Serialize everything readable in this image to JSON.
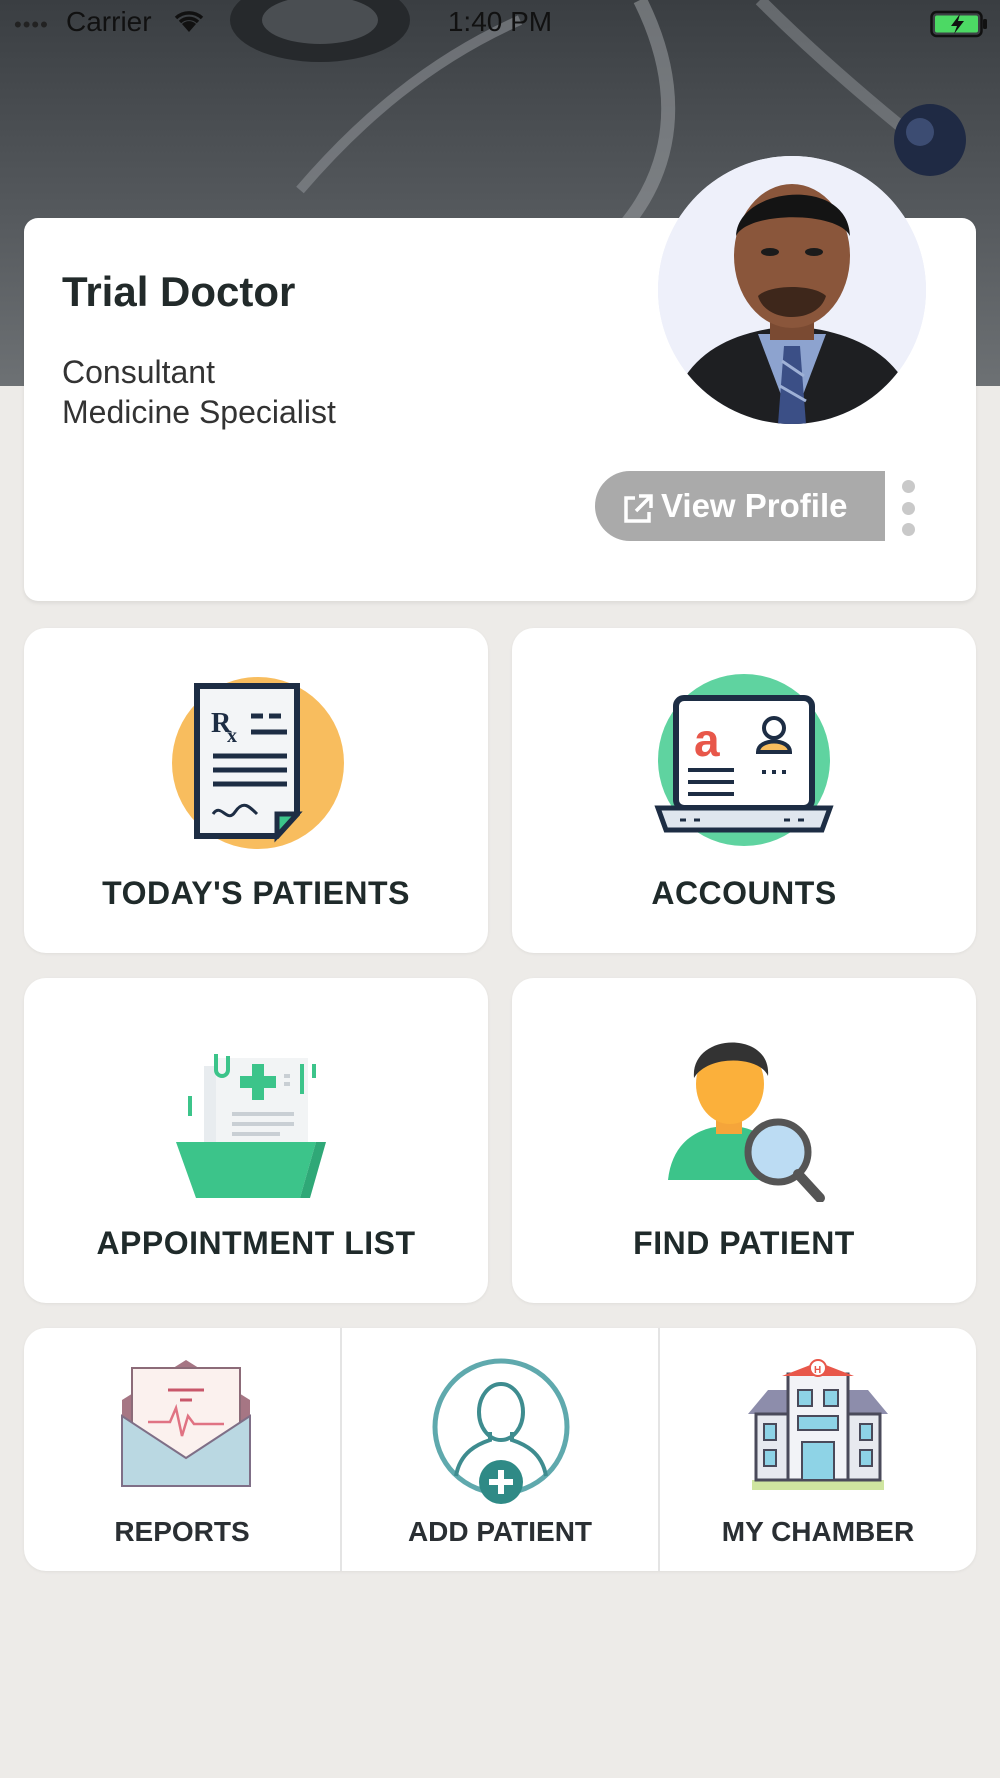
{
  "status_bar": {
    "carrier": "Carrier",
    "time": "1:40 PM"
  },
  "profile": {
    "name": "Trial Doctor",
    "title": "Consultant",
    "specialty": "Medicine Specialist",
    "view_profile_label": "View Profile"
  },
  "tiles": {
    "todays_patients": "TODAY'S PATIENTS",
    "accounts": "ACCOUNTS",
    "appointment_list": "APPOINTMENT LIST",
    "find_patient": "FIND PATIENT",
    "reports": "REPORTS",
    "add_patient": "ADD PATIENT",
    "my_chamber": "MY CHAMBER"
  },
  "icons": {
    "todays_patients": "prescription-icon",
    "accounts": "laptop-account-icon",
    "appointment_list": "medical-folder-icon",
    "find_patient": "person-search-icon",
    "reports": "medical-report-envelope-icon",
    "add_patient": "add-person-icon",
    "my_chamber": "hospital-building-icon"
  },
  "colors": {
    "background": "#edebe8",
    "card": "#ffffff",
    "button_grey": "#aaaaaa",
    "text_dark": "#222a2a",
    "accent_green": "#3cc48a",
    "accent_orange": "#f8bd5e"
  }
}
